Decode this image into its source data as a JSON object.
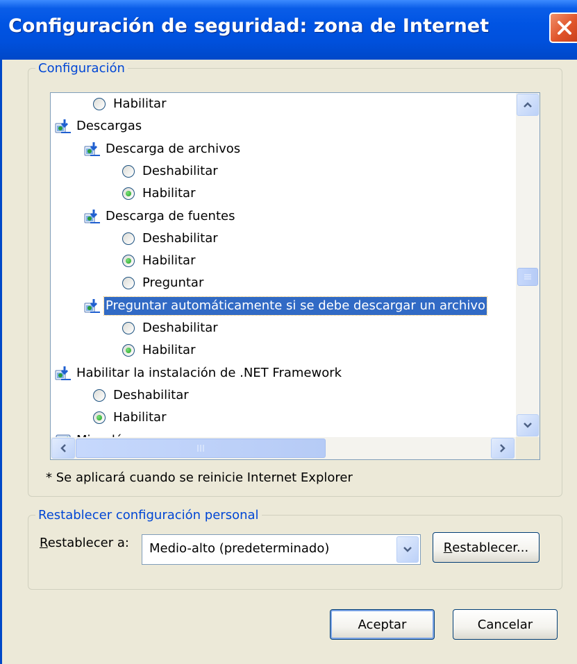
{
  "window": {
    "title": "Configuración de seguridad: zona de Internet"
  },
  "settings_group": {
    "legend": "Configuración",
    "tree_rows": [
      {
        "kind": "radio",
        "label": "Habilitar",
        "checked": false,
        "indent": 1
      },
      {
        "kind": "group",
        "label": "Descargas",
        "indent": 0
      },
      {
        "kind": "group",
        "label": "Descarga de archivos",
        "indent": 1
      },
      {
        "kind": "radio",
        "label": "Deshabilitar",
        "checked": false,
        "indent": 2
      },
      {
        "kind": "radio",
        "label": "Habilitar",
        "checked": true,
        "indent": 2
      },
      {
        "kind": "group",
        "label": "Descarga de fuentes",
        "indent": 1
      },
      {
        "kind": "radio",
        "label": "Deshabilitar",
        "checked": false,
        "indent": 2
      },
      {
        "kind": "radio",
        "label": "Habilitar",
        "checked": true,
        "indent": 2
      },
      {
        "kind": "radio",
        "label": "Preguntar",
        "checked": false,
        "indent": 2
      },
      {
        "kind": "group",
        "label": "Preguntar automáticamente si se debe descargar un archivo",
        "indent": 1,
        "selected": true
      },
      {
        "kind": "radio",
        "label": "Deshabilitar",
        "checked": false,
        "indent": 2
      },
      {
        "kind": "radio",
        "label": "Habilitar",
        "checked": true,
        "indent": 2
      },
      {
        "kind": "group",
        "label": "Habilitar la instalación de .NET Framework",
        "indent": 0
      },
      {
        "kind": "radio",
        "label": "Deshabilitar",
        "checked": false,
        "indent": 1
      },
      {
        "kind": "radio",
        "label": "Habilitar",
        "checked": true,
        "indent": 1
      },
      {
        "kind": "misc",
        "label": "Miscelánea",
        "indent": 0
      }
    ],
    "note": "* Se aplicará cuando se reinicie Internet Explorer"
  },
  "reset_group": {
    "legend": "Restablecer configuración personal",
    "label_access_key": "R",
    "label_rest": "establecer a:",
    "selected_level": "Medio-alto (predeterminado)",
    "button_access_key": "R",
    "button_rest": "establecer..."
  },
  "buttons": {
    "ok": "Aceptar",
    "cancel": "Cancelar"
  },
  "colors": {
    "title_bar": "#0054e3",
    "selection": "#316ac5",
    "legend_text": "#0046d5",
    "close_button": "#e0542a",
    "radio_dot": "#21a121"
  }
}
